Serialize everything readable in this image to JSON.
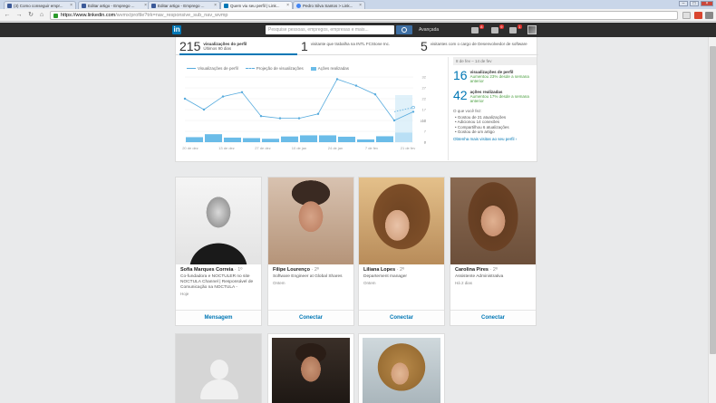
{
  "browser": {
    "tabs": [
      {
        "label": "(3) Como conseguir empr...",
        "icon": "facebook-favicon-icon",
        "active": false
      },
      {
        "label": "Editar artigo - Emprego ...",
        "icon": "facebook-favicon-icon",
        "active": false
      },
      {
        "label": "Editar artigo - Emprego ...",
        "icon": "facebook-favicon-icon",
        "active": false
      },
      {
        "label": "Quem viu seu perfil | Link...",
        "icon": "linkedin-favicon-icon",
        "active": true
      },
      {
        "label": "Pedro Silva Santos > Link...",
        "icon": "google-favicon-icon",
        "active": false
      }
    ],
    "url_host": "https://www.linkedin.com",
    "url_path": "/wvmx/profile?trk=nav_responsive_sub_nav_wvmp"
  },
  "header": {
    "logo": "in",
    "search_placeholder": "Pesquise pessoas, empregos, empresas e mais...",
    "advanced": "Avançada",
    "badges": [
      "8",
      "9",
      "1"
    ]
  },
  "stats": {
    "tabs": [
      {
        "num": "215",
        "title": "visualizações do perfil",
        "sub": "Últimos 90 dias"
      },
      {
        "num": "1",
        "title": "",
        "sub": "visitante que trabalha na INTL FCStone Inc."
      },
      {
        "num": "5",
        "title": "",
        "sub": "visitantes com o cargo de Desenvolvedor de software"
      }
    ],
    "legend": [
      "Visualizações de perfil",
      "Projeção de visualizações",
      "Ações realizadas"
    ],
    "range": "8 de fev – 14 de fev",
    "kpis": [
      {
        "num": "16",
        "title": "visualizações de perfil",
        "trend": "Aumentou 23% desde a semana anterior"
      },
      {
        "num": "42",
        "title": "ações realizadas",
        "trend": "Aumentou 17% desde a semana anterior"
      }
    ],
    "what_title": "O que você fez:",
    "what_items": [
      "Gostou de 21 atualizações",
      "Adicionou 14 conexões",
      "Compartilhou 6 atualizações",
      "Gostou de um artigo"
    ],
    "more_link": "Obtenha mais visitas ao seu perfil ›"
  },
  "chart_data": {
    "type": "line",
    "x": [
      "20 de dez",
      "13 de dez",
      "27 de dez",
      "10 de jan",
      "24 de jan",
      "7 de fev",
      "21 de fev"
    ],
    "series": [
      {
        "name": "Visualizações de perfil",
        "values": [
          22,
          17,
          23,
          25,
          14,
          13,
          13,
          15,
          31,
          28,
          24,
          12,
          16
        ]
      },
      {
        "name": "Projeção de visualizações",
        "values": [
          null,
          null,
          null,
          null,
          null,
          null,
          null,
          null,
          null,
          null,
          null,
          16,
          18
        ]
      },
      {
        "name": "Ações realizadas",
        "values": [
          22,
          35,
          20,
          18,
          15,
          25,
          30,
          30,
          24,
          12,
          26,
          42
        ]
      }
    ],
    "y_left_ticks": [
      "32",
      "27",
      "22",
      "17",
      "12",
      "7",
      "2"
    ],
    "y_right_ticks": [
      "100",
      "0"
    ]
  },
  "cards": [
    {
      "name": "Sofia Marques Correia",
      "degree": "· 1º",
      "desc": "Co-fundadora e NOCTULER no site NOCTULA Channel | Responsável de Comunicação na NOCTULA -",
      "when": "Hoje",
      "action": "Mensagem"
    },
    {
      "name": "Filipe Lourenço",
      "degree": "· 2º",
      "desc": "Software Engineer at Global Shares",
      "when": "Ontem",
      "action": "Conectar"
    },
    {
      "name": "Liliana Lopes",
      "degree": "· 2º",
      "desc": "Departement manager",
      "when": "Ontem",
      "action": "Conectar"
    },
    {
      "name": "Carolina Pires",
      "degree": "· 2º",
      "desc": "Assistente Administrativa",
      "when": "Há 2 dias",
      "action": "Conectar"
    }
  ]
}
